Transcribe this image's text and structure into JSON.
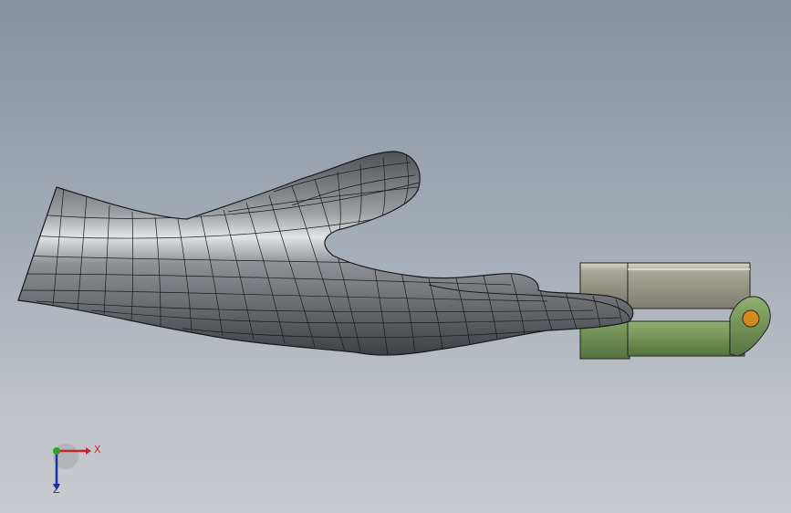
{
  "viewport": {
    "background_top": "#87919f",
    "background_bottom": "#c8cbcf"
  },
  "model": {
    "hand": {
      "surface_color": "#6a6d71",
      "mesh_color": "#1a1a1a"
    },
    "gripper": {
      "upper_color": "#8c8a7e",
      "lower_color": "#6f8f57",
      "pin_color": "#d28a1e"
    }
  },
  "triad": {
    "x_label": "X",
    "z_label": "Z",
    "x_color": "#c6262a",
    "y_color": "#2aa52a",
    "z_color": "#1d2f9c",
    "icon": "view-orientation-triad-icon"
  }
}
